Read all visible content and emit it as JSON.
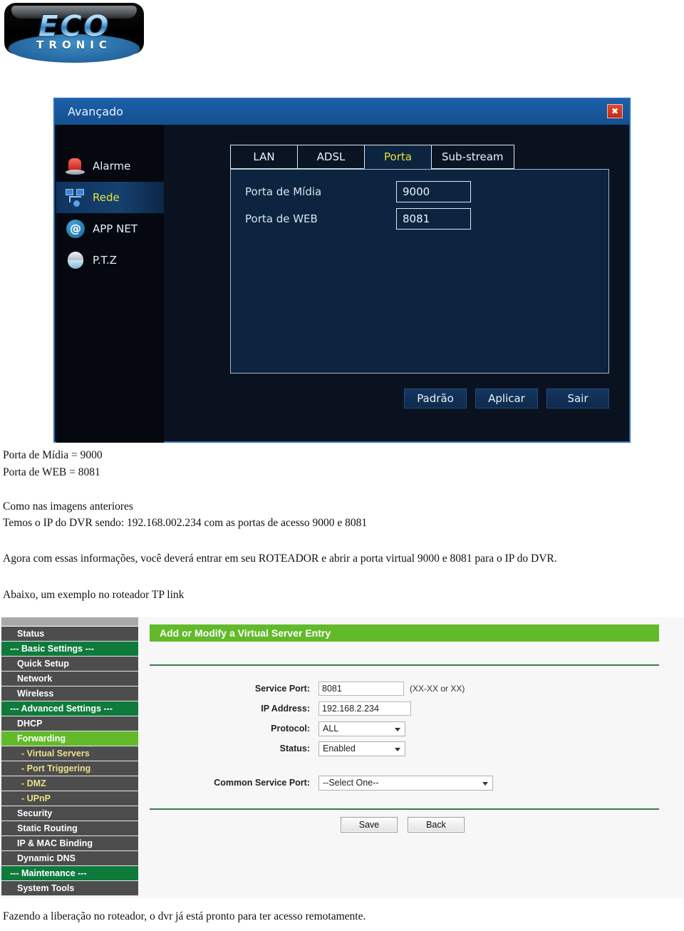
{
  "logo": {
    "primary": "ECO",
    "secondary": "TRONIC"
  },
  "dvr": {
    "title": "Avançado",
    "close_label": "✖",
    "sidebar": [
      {
        "label": "Alarme",
        "icon": "siren-icon",
        "active": false
      },
      {
        "label": "Rede",
        "icon": "network-icon",
        "active": true
      },
      {
        "label": "APP NET",
        "icon": "at-icon",
        "active": false
      },
      {
        "label": "P.T.Z",
        "icon": "dome-camera-icon",
        "active": false
      }
    ],
    "at_glyph": "@",
    "tabs": [
      {
        "label": "LAN",
        "active": false
      },
      {
        "label": "ADSL",
        "active": false
      },
      {
        "label": "Porta",
        "active": true
      },
      {
        "label": "Sub-stream",
        "active": false
      }
    ],
    "fields": [
      {
        "label": "Porta de Mídia",
        "value": "9000"
      },
      {
        "label": "Porta de WEB",
        "value": "8081"
      }
    ],
    "buttons": [
      "Padrão",
      "Aplicar",
      "Sair"
    ],
    "accent_title_bg": "#1b5fa8",
    "accent_selected_tab_text": "#e4e43a"
  },
  "doc": {
    "line1": "Porta de Mídia = 9000",
    "line2": "Porta de WEB = 8081",
    "line3": "Como nas imagens anteriores",
    "line4": "Temos o IP do DVR sendo: 192.168.002.234 com as portas de acesso 9000 e 8081",
    "line5": "Agora com essas informações, você deverá entrar em seu ROTEADOR e abrir a porta virtual 9000 e 8081 para o IP do DVR.",
    "line6": "Abaixo, um exemplo no roteador TP link",
    "footer": "Fazendo a liberação no roteador, o dvr já está pronto para ter acesso remotamente."
  },
  "router": {
    "menu": [
      {
        "label": "Status",
        "type": "item"
      },
      {
        "label": "--- Basic Settings ---",
        "type": "hdr"
      },
      {
        "label": "Quick Setup",
        "type": "item"
      },
      {
        "label": "Network",
        "type": "item"
      },
      {
        "label": "Wireless",
        "type": "item"
      },
      {
        "label": "--- Advanced Settings ---",
        "type": "hdr"
      },
      {
        "label": "DHCP",
        "type": "item"
      },
      {
        "label": "Forwarding",
        "type": "on"
      },
      {
        "label": "- Virtual Servers",
        "type": "sub"
      },
      {
        "label": "- Port Triggering",
        "type": "sub"
      },
      {
        "label": "- DMZ",
        "type": "sub"
      },
      {
        "label": "- UPnP",
        "type": "sub"
      },
      {
        "label": "Security",
        "type": "item"
      },
      {
        "label": "Static Routing",
        "type": "item"
      },
      {
        "label": "IP & MAC Binding",
        "type": "item"
      },
      {
        "label": "Dynamic DNS",
        "type": "item"
      },
      {
        "label": "--- Maintenance ---",
        "type": "hdr"
      },
      {
        "label": "System Tools",
        "type": "item"
      }
    ],
    "panel_title": "Add or Modify a Virtual Server Entry",
    "form": {
      "service_port_label": "Service Port:",
      "service_port_value": "8081",
      "service_port_note": "(XX-XX or XX)",
      "ip_label": "IP Address:",
      "ip_value": "192.168.2.234",
      "protocol_label": "Protocol:",
      "protocol_value": "ALL",
      "status_label": "Status:",
      "status_value": "Enabled",
      "common_port_label": "Common Service Port:",
      "common_port_value": "--Select One--"
    },
    "buttons": {
      "save": "Save",
      "back": "Back"
    },
    "accent_green": "#62ba2a",
    "header_green": "#0e7a3c"
  }
}
